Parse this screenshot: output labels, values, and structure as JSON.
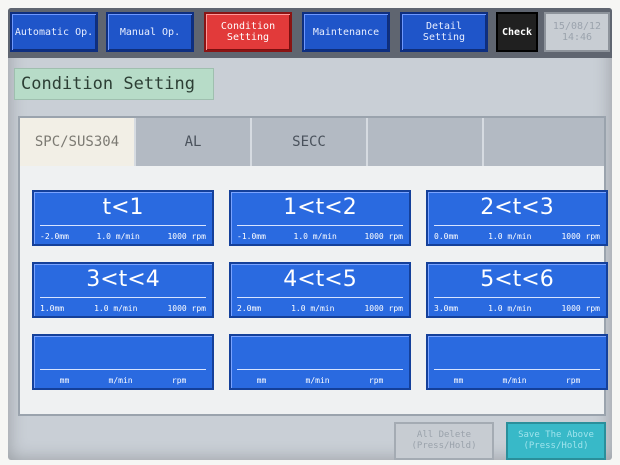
{
  "nav": {
    "automatic": "Automatic Op.",
    "manual": "Manual Op.",
    "condition": "Condition\nSetting",
    "maintenance": "Maintenance",
    "detail": "Detail\nSetting",
    "check": "Check",
    "clock": "15/08/12\n14:46"
  },
  "page_title": "Condition Setting",
  "tabs": [
    "SPC/SUS304",
    "AL",
    "SECC",
    "",
    ""
  ],
  "conditions": [
    {
      "label": "t<1",
      "mm": "-2.0mm",
      "speed": "1.0 m/min",
      "rpm": "1000 rpm"
    },
    {
      "label": "1<t<2",
      "mm": "-1.0mm",
      "speed": "1.0 m/min",
      "rpm": "1000 rpm"
    },
    {
      "label": "2<t<3",
      "mm": "0.0mm",
      "speed": "1.0 m/min",
      "rpm": "1000 rpm"
    },
    {
      "label": "3<t<4",
      "mm": "1.0mm",
      "speed": "1.0 m/min",
      "rpm": "1000 rpm"
    },
    {
      "label": "4<t<5",
      "mm": "2.0mm",
      "speed": "1.0 m/min",
      "rpm": "1000 rpm"
    },
    {
      "label": "5<t<6",
      "mm": "3.0mm",
      "speed": "1.0 m/min",
      "rpm": "1000 rpm"
    },
    {
      "label": "",
      "mm": "mm",
      "speed": "m/min",
      "rpm": "rpm"
    },
    {
      "label": "",
      "mm": "mm",
      "speed": "m/min",
      "rpm": "rpm"
    },
    {
      "label": "",
      "mm": "mm",
      "speed": "m/min",
      "rpm": "rpm"
    }
  ],
  "actions": {
    "all_delete": "All Delete\n(Press/Hold)",
    "save": "Save The Above\n(Press/Hold)"
  }
}
